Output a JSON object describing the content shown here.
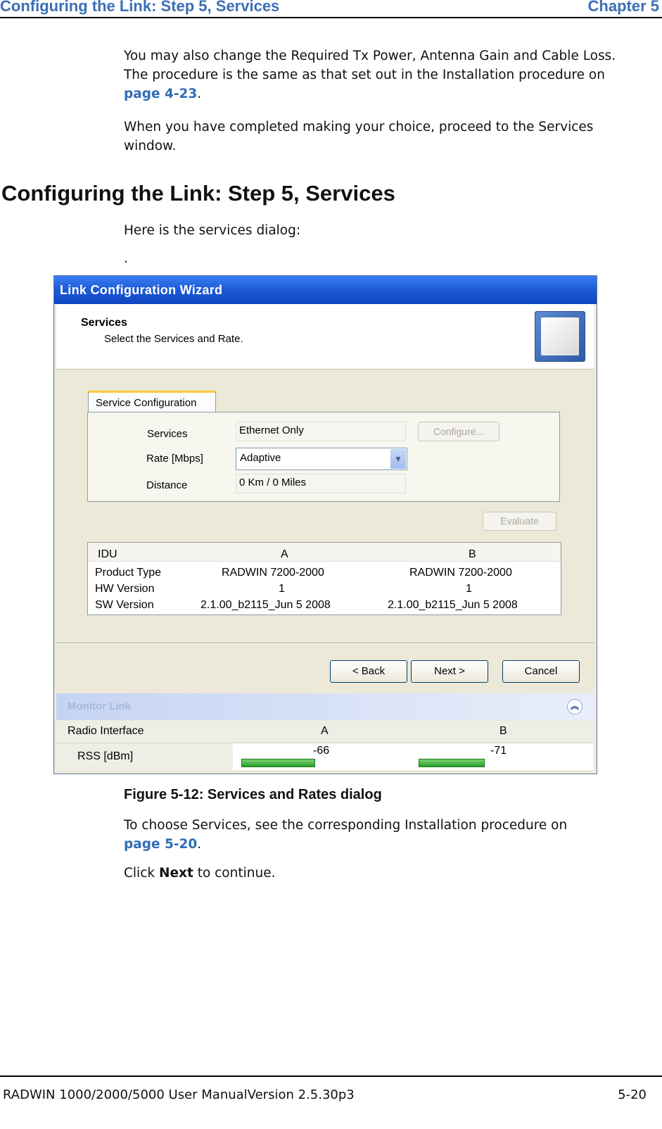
{
  "header": {
    "left": "Configuring the Link: Step 5, Services",
    "right": "Chapter 5"
  },
  "intro": {
    "p1_text": "You may also change the Required Tx Power, Antenna Gain and Cable Loss. The procedure is the same as that set out in the Installation procedure on",
    "p1_line1": "You may also change the Required Tx Power, Antenna Gain and Cable Loss.",
    "p1_line2": "The procedure is the same as that set out in the Installation procedure on",
    "p1_link": "page 4-23",
    "p2_line1": "When you have completed making your choice, proceed to the Services",
    "p2_line2": "window."
  },
  "section": {
    "title": "Configuring the Link: Step 5, Services",
    "lead": "Here is the services dialog:",
    "dot": "."
  },
  "dialog": {
    "title": "Link Configuration Wizard",
    "header_title": "Services",
    "header_subtitle": "Select the Services and Rate.",
    "tab_label": "Service Configuration",
    "fields": {
      "services_label": "Services",
      "services_value": "Ethernet Only",
      "configure_button": "Configure...",
      "rate_label": "Rate [Mbps]",
      "rate_value": "Adaptive",
      "distance_label": "Distance",
      "distance_value": "0 Km / 0 Miles"
    },
    "evaluate_button": "Evaluate",
    "idu_table": {
      "headers": [
        "IDU",
        "A",
        "B"
      ],
      "rows": [
        [
          "Product Type",
          "RADWIN 7200-2000",
          "RADWIN 7200-2000"
        ],
        [
          "HW Version",
          "1",
          "1"
        ],
        [
          "SW Version",
          "2.1.00_b2115_Jun  5 2008",
          "2.1.00_b2115_Jun  5 2008"
        ]
      ]
    },
    "buttons": {
      "back": "< Back",
      "next": "Next >",
      "cancel": "Cancel"
    },
    "monitor": {
      "title": "Monitor Link",
      "headers": [
        "Radio Interface",
        "A",
        "B"
      ],
      "rss_label": "RSS [dBm]",
      "rss_a": "-66",
      "rss_b": "-71",
      "rss_a_level": 0.62,
      "rss_b_level": 0.55
    }
  },
  "caption": "Figure 5-12: Services and Rates dialog",
  "after": {
    "p1_line1": "To choose Services, see the corresponding Installation procedure on",
    "p1_link": "page 5-20",
    "p2_pre": "Click",
    "p2_bold": "Next",
    "p2_post": "to continue."
  },
  "footer": {
    "left": "RADWIN 1000/2000/5000 User ManualVersion  2.5.30p3",
    "right": "5-20"
  }
}
